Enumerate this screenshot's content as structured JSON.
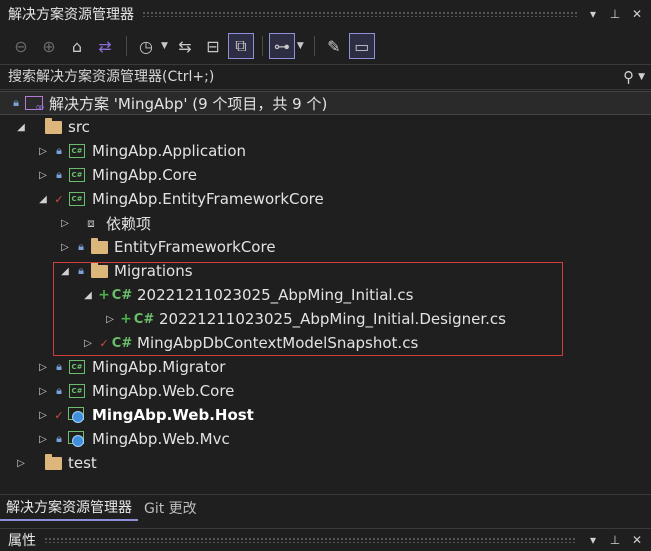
{
  "window": {
    "title": "解决方案资源管理器",
    "buttons": {
      "dropdown": "▾",
      "pin": "⊥",
      "close": "✕"
    }
  },
  "toolbar": {
    "icons": [
      "back-icon",
      "forward-icon",
      "home-icon",
      "vs-switch-icon",
      "history-icon",
      "sync-icon",
      "collapse-all-icon",
      "show-all-files-icon",
      "view-tree-icon",
      "properties-wrench-icon",
      "preview-icon"
    ]
  },
  "search": {
    "placeholder": "搜索解决方案资源管理器(Ctrl+;)"
  },
  "tree": {
    "solution": "解决方案 'MingAbp' (9 个项目，共 9 个)",
    "src": "src",
    "application": "MingAbp.Application",
    "core": "MingAbp.Core",
    "efcore": "MingAbp.EntityFrameworkCore",
    "deps": "依赖项",
    "efcore_folder": "EntityFrameworkCore",
    "migrations": "Migrations",
    "initial": "20221211023025_AbpMing_Initial.cs",
    "initial_designer": "20221211023025_AbpMing_Initial.Designer.cs",
    "snapshot": "MingAbpDbContextModelSnapshot.cs",
    "migrator": "MingAbp.Migrator",
    "webcore": "MingAbp.Web.Core",
    "webhost": "MingAbp.Web.Host",
    "webmvc": "MingAbp.Web.Mvc",
    "test": "test",
    "cs_badge": "C#",
    "csproj_badge": "C#"
  },
  "bottom_tabs": {
    "solution_explorer": "解决方案资源管理器",
    "git_changes": "Git 更改"
  },
  "properties": {
    "title": "属性"
  },
  "colors": {
    "accent": "#8f8fd8",
    "highlight_border": "#d23c3c",
    "folder": "#dcb67a",
    "csharp": "#6bbf6b"
  }
}
